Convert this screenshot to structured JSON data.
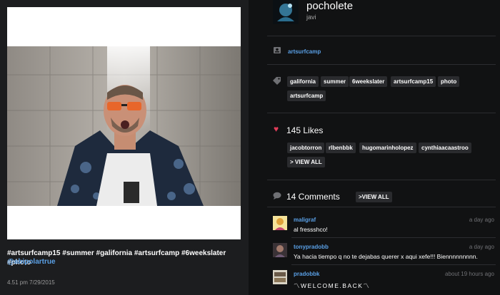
{
  "post": {
    "caption": "#artsurfcamp15 #summer #galifornia #artsurfcamp #6weekslater #photo",
    "mention": "@abipolartrue",
    "date": "4.51 pm 7/29/2015"
  },
  "user": {
    "username": "pocholete",
    "fullname": "javi"
  },
  "location": {
    "icon": "id-card-icon",
    "name": "artsurfcamp"
  },
  "tags": {
    "icon": "tag-icon",
    "items": [
      "galifornia",
      "summer",
      "6weekslater",
      "artsurfcamp15",
      "photo",
      "artsurfcamp"
    ]
  },
  "likes": {
    "icon": "heart-icon",
    "title": "145 Likes",
    "users": [
      "jacobtorron",
      "rlbenbbk",
      "hugomarinholopez",
      "cynthiaacaastroo"
    ],
    "view_all": "> VIEW ALL"
  },
  "comments": {
    "icon": "speech-bubble-icon",
    "title": "14 Comments",
    "view_all": ">VIEW ALL",
    "items": [
      {
        "user": "maligraf",
        "time": "a day ago",
        "text": "al fressshco!"
      },
      {
        "user": "tonypradobb",
        "time": "a day ago",
        "text": "Ya hacia tiempo q no te dejabas querer x aqui xefe!!! Biennnnnnnnn."
      },
      {
        "user": "pradobbk",
        "time": "about 19 hours ago",
        "text": "〽WELCOME.BACK〽"
      }
    ]
  },
  "colors": {
    "accent": "#5aa0e6",
    "heart": "#e23d5a",
    "panel": "#111213",
    "tag_bg": "#2a2b2e"
  }
}
